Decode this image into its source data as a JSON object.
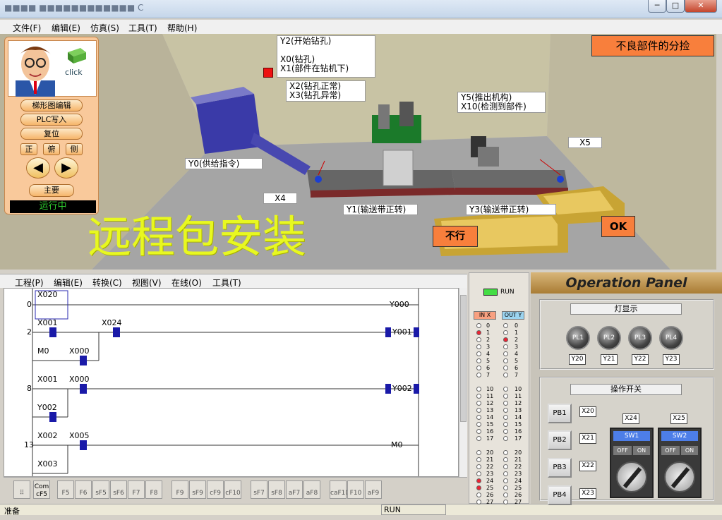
{
  "window": {
    "title": "■■■■ ■■■■■■■■■■■■ C",
    "min": "─",
    "max": "□",
    "close": "✕"
  },
  "menu1": [
    "文件(F)",
    "编辑(E)",
    "仿真(S)",
    "工具(T)",
    "帮助(H)"
  ],
  "sidebar": {
    "click": "click",
    "buttons": [
      "梯形图编辑",
      "PLC写入",
      "复位"
    ],
    "views": [
      "正",
      "俯",
      "侧"
    ],
    "main": "主要",
    "status": "运行中"
  },
  "scene": {
    "title_button": "不良部件的分捡",
    "watermark": "远程包安装",
    "labels": {
      "y2": "Y2(开始钻孔)\n\nX0(钻孔)\nX1(部件在钻机下)",
      "x2": "X2(钻孔正常)\nX3(钻孔异常)",
      "y5": "Y5(推出机构)\nX10(检测到部件)",
      "x5": "X5",
      "y0": "Y0(供给指令)",
      "x4": "X4",
      "y1": "Y1(输送带正转)",
      "y3": "Y3(输送带正转)"
    },
    "ng": "不行",
    "ok": "OK"
  },
  "menu2": [
    "工程(P)",
    "编辑(E)",
    "转换(C)",
    "视图(V)",
    "在线(O)",
    "工具(T)"
  ],
  "ladder": {
    "rungs": [
      {
        "num": "0",
        "contacts": [
          "X020"
        ],
        "coil": "Y000"
      },
      {
        "num": "2",
        "contacts": [
          "X001",
          "X024",
          "M0",
          "X000"
        ],
        "coil": "Y001"
      },
      {
        "num": "8",
        "contacts": [
          "X001",
          "X000",
          "Y002"
        ],
        "coil": "Y002"
      },
      {
        "num": "13",
        "contacts": [
          "X002",
          "X005",
          "X003"
        ],
        "coil": "M0"
      }
    ]
  },
  "fkeys": [
    "Com cF5",
    "F5",
    "F6",
    "sF5",
    "sF6",
    "F7",
    "F8",
    "F9",
    "sF9",
    "cF9",
    "cF10",
    "sF7",
    "sF8",
    "aF7",
    "aF8",
    "caF10",
    "F10",
    "aF9"
  ],
  "status": {
    "left": "准备",
    "run": "RUN"
  },
  "io": {
    "run": "RUN",
    "in_label": "IN X",
    "out_label": "OUT Y",
    "group1": [
      "0",
      "1",
      "2",
      "3",
      "4",
      "5",
      "6",
      "7"
    ],
    "group2": [
      "10",
      "11",
      "12",
      "13",
      "14",
      "15",
      "16",
      "17"
    ],
    "group3": [
      "20",
      "21",
      "22",
      "23",
      "24",
      "25",
      "26",
      "27"
    ],
    "in_on": [
      "1",
      "24",
      "25"
    ],
    "out_on": [
      "2"
    ]
  },
  "op": {
    "title": "Operation Panel",
    "lamp_section": "灯显示",
    "lamps": [
      "PL1",
      "PL2",
      "PL3",
      "PL4"
    ],
    "lamp_tags": [
      "Y20",
      "Y21",
      "Y22",
      "Y23"
    ],
    "switch_section": "操作开关",
    "pbs": [
      "PB1",
      "PB2",
      "PB3",
      "PB4"
    ],
    "pb_tags": [
      "X20",
      "X21",
      "X22",
      "X23"
    ],
    "sw_tags": [
      "X24",
      "X25"
    ],
    "sws": [
      "SW1",
      "SW2"
    ],
    "off": "OFF",
    "on": "ON"
  },
  "colors": {
    "accent": "#f87f3c",
    "coil": "#1a1aa8",
    "led_on": "#e22233"
  }
}
